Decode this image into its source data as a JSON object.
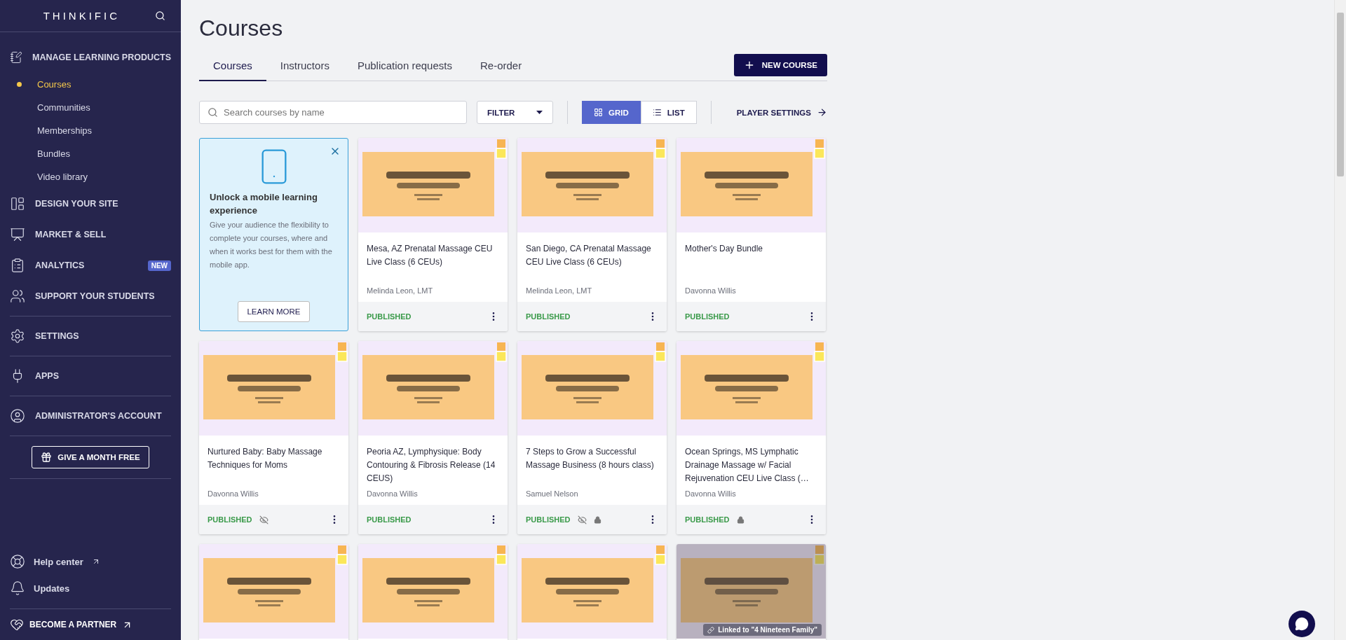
{
  "sidebar": {
    "logo": "THINKIFIC",
    "nav_groups": [
      [
        {
          "label": "MANAGE LEARNING PRODUCTS",
          "children": [
            {
              "label": "Courses",
              "selected": true
            },
            {
              "label": "Communities",
              "selected": false
            },
            {
              "label": "Memberships",
              "selected": false
            },
            {
              "label": "Bundles",
              "selected": false
            },
            {
              "label": "Video library",
              "selected": false
            }
          ]
        },
        {
          "label": "DESIGN YOUR SITE"
        },
        {
          "label": "MARKET & SELL"
        },
        {
          "label": "ANALYTICS",
          "badge": "NEW"
        },
        {
          "label": "SUPPORT YOUR STUDENTS"
        }
      ],
      [
        {
          "label": "SETTINGS"
        }
      ],
      [
        {
          "label": "APPS"
        }
      ],
      [
        {
          "label": "ADMINISTRATOR'S ACCOUNT"
        }
      ]
    ],
    "promo_button": "GIVE A MONTH FREE",
    "footer_links": [
      {
        "label": "Help center",
        "external": true
      },
      {
        "label": "Updates",
        "external": false
      }
    ],
    "partner_link": "BECOME A PARTNER"
  },
  "page": {
    "title": "Courses",
    "tabs": [
      {
        "label": "Courses",
        "selected": true
      },
      {
        "label": "Instructors",
        "selected": false
      },
      {
        "label": "Publication requests",
        "selected": false
      },
      {
        "label": "Re-order",
        "selected": false
      }
    ],
    "new_button": "NEW COURSE",
    "search": {
      "placeholder": "Search courses by name"
    },
    "filter": "FILTER",
    "views": [
      {
        "label": "GRID",
        "selected": true
      },
      {
        "label": "LIST",
        "selected": false
      }
    ],
    "player_settings": "PLAYER SETTINGS",
    "cards": [
      {
        "kind": "promo",
        "title": "Unlock a mobile learning experience",
        "text": "Give your audience the flexibility to complete your courses, where and when it works best for them with the mobile app.",
        "button": "LEARN MORE"
      },
      {
        "kind": "course",
        "title": "Mesa, AZ Prenatal Massage CEU Live Class (6 CEUs)",
        "author": "Melinda Leon, LMT",
        "status": "PUBLISHED",
        "hidden": false,
        "locked": false
      },
      {
        "kind": "course",
        "title": "San Diego, CA Prenatal Massage CEU Live Class (6 CEUs)",
        "author": "Melinda Leon, LMT",
        "status": "PUBLISHED",
        "hidden": false,
        "locked": false
      },
      {
        "kind": "course",
        "title": "Mother's Day Bundle",
        "author": "Davonna Willis",
        "status": "PUBLISHED",
        "hidden": false,
        "locked": false
      },
      {
        "kind": "course",
        "title": "Nurtured Baby: Baby Massage Techniques for Moms",
        "author": "Davonna Willis",
        "status": "PUBLISHED",
        "hidden": true,
        "locked": false
      },
      {
        "kind": "course",
        "title": "Peoria AZ, Lymphysique: Body Contouring & Fibrosis Release (14 CEUS)",
        "author": "Davonna Willis",
        "status": "PUBLISHED",
        "hidden": false,
        "locked": false
      },
      {
        "kind": "course",
        "title": "7 Steps to Grow a Successful Massage Business (8 hours class)",
        "author": "Samuel Nelson",
        "status": "PUBLISHED",
        "hidden": true,
        "locked": true
      },
      {
        "kind": "course",
        "title": "Ocean Springs, MS Lymphatic Drainage Massage w/ Facial Rejuvenation CEU Live Class (…",
        "author": "Davonna Willis",
        "status": "PUBLISHED",
        "hidden": false,
        "locked": true
      },
      {
        "kind": "course"
      },
      {
        "kind": "course"
      },
      {
        "kind": "course"
      },
      {
        "kind": "course",
        "linked": "Linked to \"4 Nineteen Family\""
      }
    ]
  }
}
